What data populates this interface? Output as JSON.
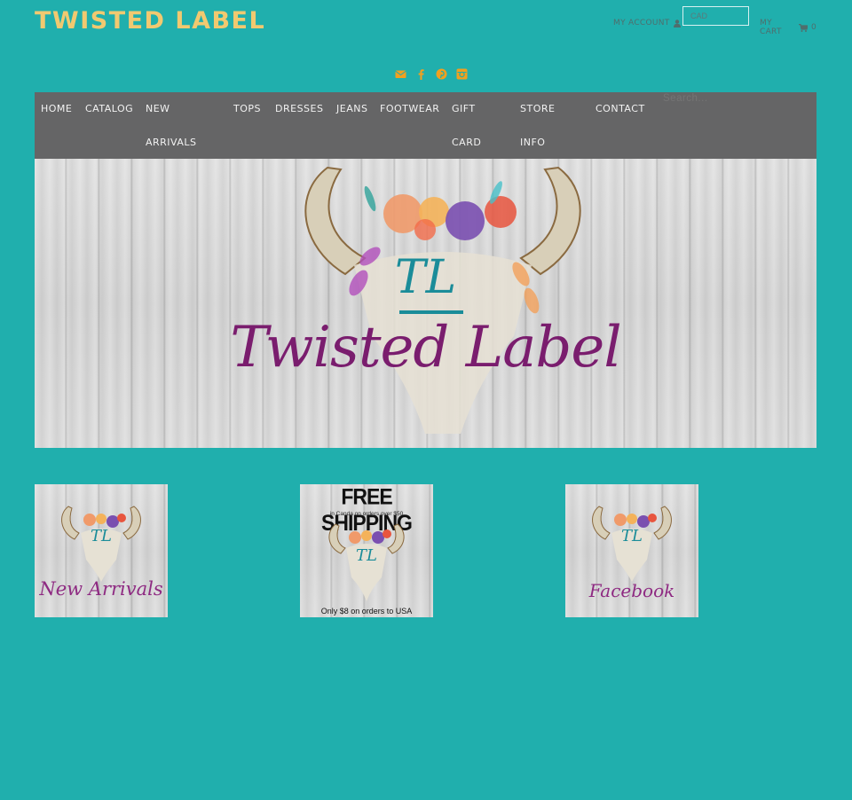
{
  "header": {
    "store_name": "TWISTED LABEL",
    "account_label": "MY ACCOUNT",
    "account_icon": "user-icon",
    "currency_value": "CAD",
    "cart_label": "MY CART",
    "cart_icon": "cart-icon",
    "cart_count": "0"
  },
  "social": [
    {
      "name": "email",
      "icon": "envelope-icon"
    },
    {
      "name": "facebook",
      "icon": "facebook-icon"
    },
    {
      "name": "pinterest",
      "icon": "pinterest-icon"
    },
    {
      "name": "instagram",
      "icon": "instagram-icon"
    }
  ],
  "colors": {
    "background": "#20afad",
    "logo": "#f1c970",
    "nav_bg": "#656566",
    "social_icons": "#f0a020",
    "brand_purple": "#7a1d6e",
    "brand_teal": "#1a8c99"
  },
  "nav": {
    "items": [
      {
        "line1": "HOME",
        "line2": ""
      },
      {
        "line1": "CATALOG",
        "line2": ""
      },
      {
        "line1": "NEW",
        "line2": "ARRIVALS"
      },
      {
        "line1": "TOPS",
        "line2": ""
      },
      {
        "line1": "DRESSES",
        "line2": ""
      },
      {
        "line1": "JEANS",
        "line2": ""
      },
      {
        "line1": "FOOTWEAR",
        "line2": ""
      },
      {
        "line1": "GIFT",
        "line2": "CARD"
      },
      {
        "line1": "STORE",
        "line2": "INFO"
      },
      {
        "line1": "CONTACT",
        "line2": ""
      }
    ],
    "search_placeholder": "Search..."
  },
  "banner": {
    "monogram": "TL",
    "title": "Twisted Label"
  },
  "tiles": [
    {
      "monogram": "TL",
      "caption": "New Arrivals"
    },
    {
      "headline": "FREE SHIPPING",
      "subline": "in Canda on orders over $50",
      "monogram": "TL",
      "footer": "Only $8 on orders to USA"
    },
    {
      "monogram": "TL",
      "caption": "Facebook"
    }
  ]
}
